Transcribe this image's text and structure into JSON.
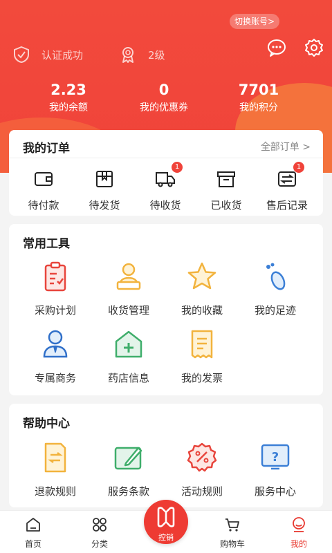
{
  "header": {
    "switch_account": "切换账号>",
    "verified": "认证成功",
    "level": "2级",
    "stats": [
      {
        "value": "2.23",
        "label": "我的余额"
      },
      {
        "value": "0",
        "label": "我的优惠券"
      },
      {
        "value": "7701",
        "label": "我的积分"
      }
    ]
  },
  "orders": {
    "title": "我的订单",
    "all_link": "全部订单 >",
    "items": [
      {
        "label": "待付款",
        "icon": "wallet-icon",
        "badge": ""
      },
      {
        "label": "待发货",
        "icon": "package-icon",
        "badge": ""
      },
      {
        "label": "待收货",
        "icon": "truck-icon",
        "badge": "1"
      },
      {
        "label": "已收货",
        "icon": "box-icon",
        "badge": ""
      },
      {
        "label": "售后记录",
        "icon": "exchange-icon",
        "badge": "1"
      }
    ]
  },
  "tools": {
    "title": "常用工具",
    "items": [
      {
        "label": "采购计划",
        "icon": "clipboard-icon"
      },
      {
        "label": "收货管理",
        "icon": "receiver-icon"
      },
      {
        "label": "我的收藏",
        "icon": "star-icon"
      },
      {
        "label": "我的足迹",
        "icon": "footprint-icon"
      },
      {
        "label": "专属商务",
        "icon": "business-person-icon"
      },
      {
        "label": "药店信息",
        "icon": "pharmacy-icon"
      },
      {
        "label": "我的发票",
        "icon": "invoice-icon"
      }
    ]
  },
  "help": {
    "title": "帮助中心",
    "items": [
      {
        "label": "退款规则",
        "icon": "refund-doc-icon"
      },
      {
        "label": "服务条款",
        "icon": "terms-icon"
      },
      {
        "label": "活动规则",
        "icon": "discount-icon"
      },
      {
        "label": "服务中心",
        "icon": "question-icon"
      }
    ]
  },
  "tabbar": {
    "items": [
      {
        "label": "首页",
        "icon": "home-icon"
      },
      {
        "label": "分类",
        "icon": "category-icon"
      },
      {
        "label": "控销",
        "icon": "control-sales-icon"
      },
      {
        "label": "购物车",
        "icon": "cart-icon"
      },
      {
        "label": "我的",
        "icon": "profile-icon"
      }
    ],
    "active": "我的"
  },
  "colors": {
    "brand_red": "#f0433a",
    "gold": "#f2b33d",
    "green": "#3fae6b",
    "blue": "#3b7fd6"
  }
}
